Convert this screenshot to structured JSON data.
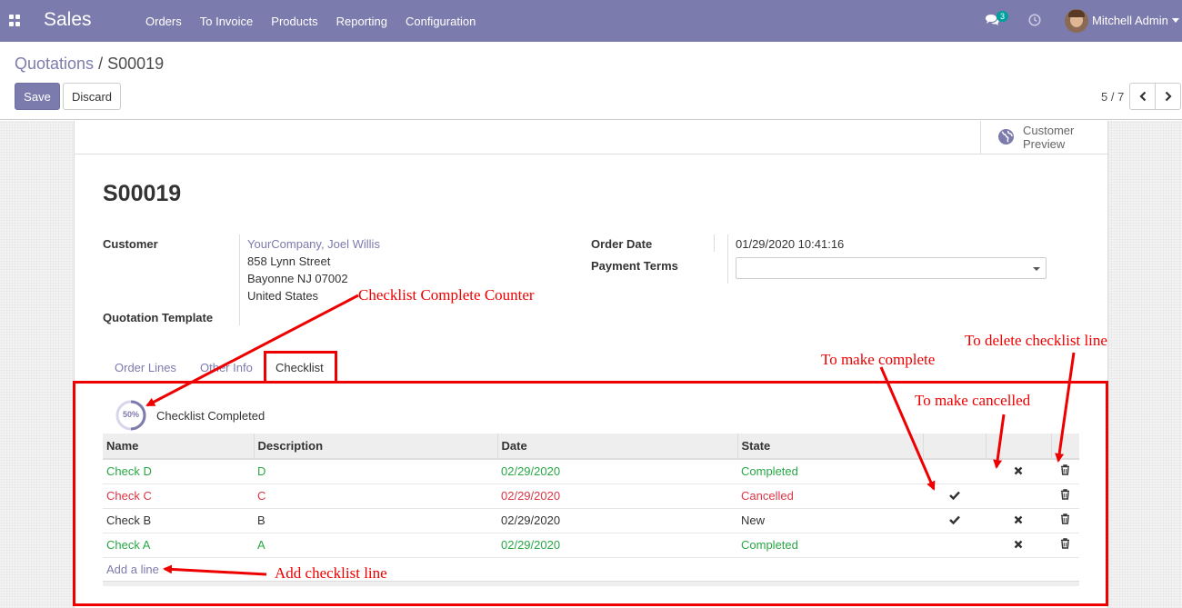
{
  "navbar": {
    "brand": "Sales",
    "menu": [
      "Orders",
      "To Invoice",
      "Products",
      "Reporting",
      "Configuration"
    ],
    "chat_count": "3",
    "user_name": "Mitchell Admin"
  },
  "control_panel": {
    "breadcrumb_parent": "Quotations",
    "breadcrumb_sep": "/",
    "breadcrumb_current": "S00019",
    "save_label": "Save",
    "discard_label": "Discard",
    "pager": "5 / 7"
  },
  "sheet": {
    "customer_preview": "Customer Preview",
    "order_name": "S00019",
    "customer_label": "Customer",
    "customer_name": "YourCompany, Joel Willis",
    "address_line1": "858 Lynn Street",
    "address_line2": "Bayonne NJ 07002",
    "address_line3": "United States",
    "quotation_template_label": "Quotation Template",
    "order_date_label": "Order Date",
    "order_date": "01/29/2020 10:41:16",
    "payment_terms_label": "Payment Terms",
    "payment_terms": ""
  },
  "tabs": [
    "Order Lines",
    "Other Info",
    "Checklist"
  ],
  "checklist": {
    "progress": "50%",
    "progress_fraction": 0.5,
    "completed_label": "Checklist Completed",
    "columns": [
      "Name",
      "Description",
      "Date",
      "State"
    ],
    "rows": [
      {
        "name": "Check D",
        "description": "D",
        "date": "02/29/2020",
        "state": "Completed"
      },
      {
        "name": "Check C",
        "description": "C",
        "date": "02/29/2020",
        "state": "Cancelled"
      },
      {
        "name": "Check B",
        "description": "B",
        "date": "02/29/2020",
        "state": "New"
      },
      {
        "name": "Check A",
        "description": "A",
        "date": "02/29/2020",
        "state": "Completed"
      }
    ],
    "add_line": "Add a line"
  },
  "annotations": {
    "counter": "Checklist Complete Counter",
    "make_complete": "To make complete",
    "make_cancelled": "To make cancelled",
    "delete_line": "To delete checklist line",
    "add_line": "Add checklist line"
  },
  "colors": {
    "brand": "#7c7bad",
    "completed": "#28a745",
    "cancelled": "#dc3545",
    "annotation": "#ee0000"
  }
}
